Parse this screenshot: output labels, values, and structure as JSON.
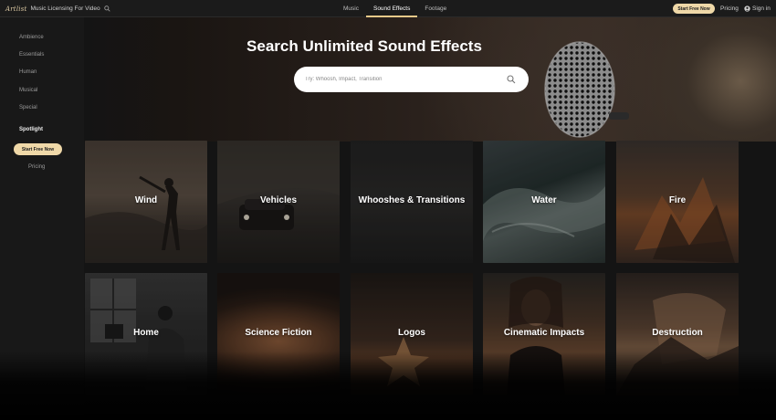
{
  "brand": {
    "logo_text": "Artlist",
    "tagline": "Music Licensing For Video"
  },
  "nav": {
    "items": [
      {
        "label": "Music"
      },
      {
        "label": "Sound Effects"
      },
      {
        "label": "Footage"
      }
    ],
    "active": "Sound Effects",
    "cta_label": "Start Free Now",
    "pricing_label": "Pricing",
    "signin_label": "Sign in"
  },
  "sidebar": {
    "items": [
      {
        "label": "Ambience"
      },
      {
        "label": "Essentials"
      },
      {
        "label": "Human"
      },
      {
        "label": "Musical"
      },
      {
        "label": "Special"
      },
      {
        "label": "Spotlight"
      }
    ],
    "cta_label": "Start Free Now",
    "pricing_label": "Pricing"
  },
  "hero": {
    "title": "Search Unlimited Sound Effects",
    "search_placeholder": "Try: Whoosh, Impact, Transition"
  },
  "categories": [
    {
      "label": "Wind"
    },
    {
      "label": "Vehicles"
    },
    {
      "label": "Whooshes & Transitions"
    },
    {
      "label": "Water"
    },
    {
      "label": "Fire"
    },
    {
      "label": "Home"
    },
    {
      "label": "Science Fiction"
    },
    {
      "label": "Logos"
    },
    {
      "label": "Cinematic Impacts"
    },
    {
      "label": "Destruction"
    }
  ],
  "colors": {
    "accent": "#efd8a8",
    "background": "#141414",
    "sidebar": "#181818"
  }
}
